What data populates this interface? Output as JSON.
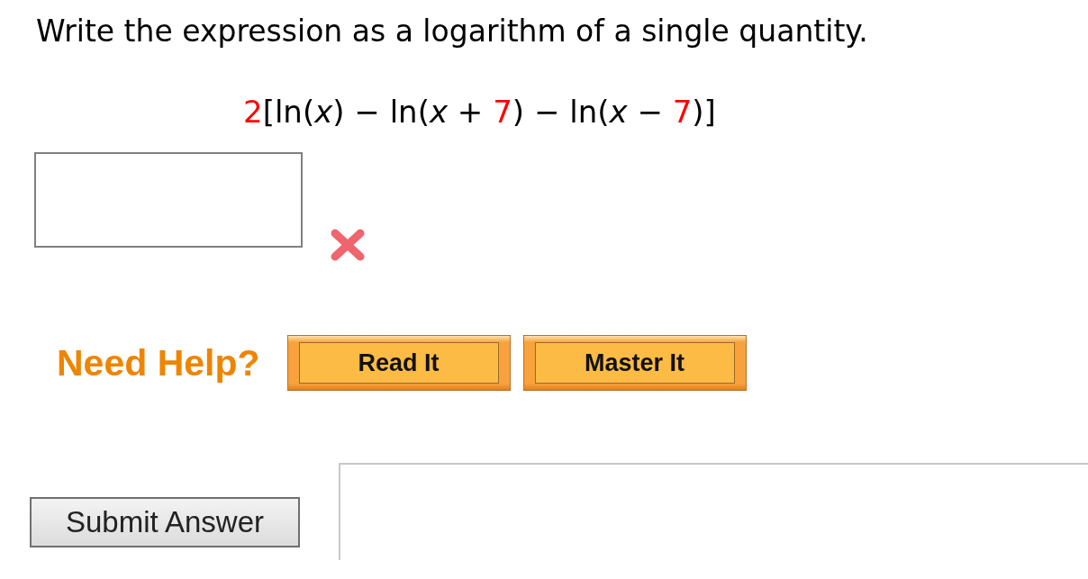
{
  "question": {
    "prompt": "Write the expression as a logarithm of a single quantity.",
    "expression": [
      {
        "text": "2",
        "color": "#ff0000"
      },
      {
        "text": "[ln(*x*) − ln(*x* + ",
        "color": "#000000"
      },
      {
        "text": "7",
        "color": "#ff0000"
      },
      {
        "text": ") − ln(*x* − ",
        "color": "#000000"
      },
      {
        "text": "7",
        "color": "#ff0000"
      },
      {
        "text": ")]",
        "color": "#000000"
      }
    ]
  },
  "answer": {
    "correct": false
  },
  "help": {
    "label": "Need Help?",
    "buttons": [
      "Read It",
      "Master It"
    ]
  },
  "submit": {
    "label": "Submit Answer"
  }
}
